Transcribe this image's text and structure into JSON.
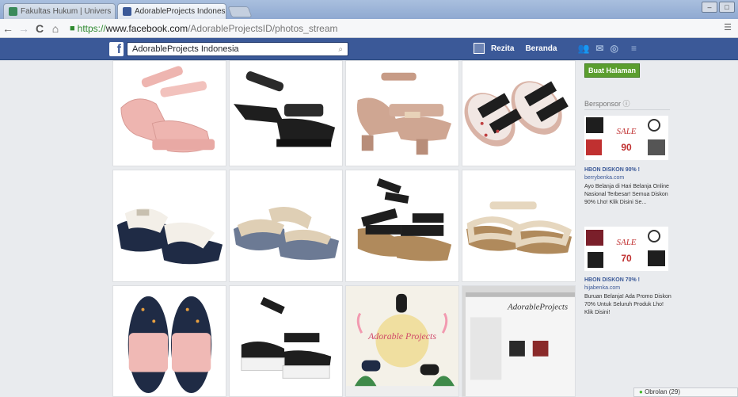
{
  "browser": {
    "tabs": [
      {
        "title": "Fakultas Hukum | Univers",
        "close": "×",
        "active": false
      },
      {
        "title": "AdorableProjects Indones",
        "close": "×",
        "active": true
      }
    ],
    "url": {
      "scheme": "https://",
      "host": "www.facebook.com",
      "path": "/AdorableProjectsID/photos_stream"
    },
    "nav": {
      "back": "←",
      "forward": "→",
      "reload": "C",
      "home": "⌂",
      "lock": "🔒"
    }
  },
  "facebook": {
    "search_value": "AdorableProjects Indonesia",
    "user_name": "Rezita",
    "home_label": "Beranda",
    "create_page_label": "Buat Halaman",
    "sponsored_label": "Bersponsor",
    "ads": [
      {
        "title": "HBON DISKON 90% !",
        "domain": "berrybenka.com",
        "body": "Ayo Belanja di Hari Belanja Online Nasional Terbesar! Semua Diskon 90% Lho! Klik Disini Se...",
        "badge": "90"
      },
      {
        "title": "HBON DISKON 70% !",
        "domain": "hijabenka.com",
        "body": "Buruan Belanja! Ada Promo Diskon 70% Untuk Seluruh Produk Lho! Klik Disini!",
        "badge": "70"
      }
    ],
    "chat_label": "Obrolan (29)",
    "promo_text": "Adorable Projects",
    "laptop_brand": "AdorableProjects",
    "ad_sale_text": "SALE"
  },
  "colors": {
    "fb_blue": "#3b5998",
    "page_bg": "#e9ebee",
    "pink": "#eeb5b0",
    "nude": "#cfa692",
    "black": "#1e1e1e",
    "cream": "#e6d7bf",
    "navy": "#1f2b45",
    "cork": "#b08a5c",
    "green_btn": "#5b9e2f"
  },
  "icons": {
    "facebook_logo": "f",
    "search": "⌕",
    "friends": "👥",
    "messages": "✉",
    "globe": "◎",
    "settings": "≡"
  }
}
